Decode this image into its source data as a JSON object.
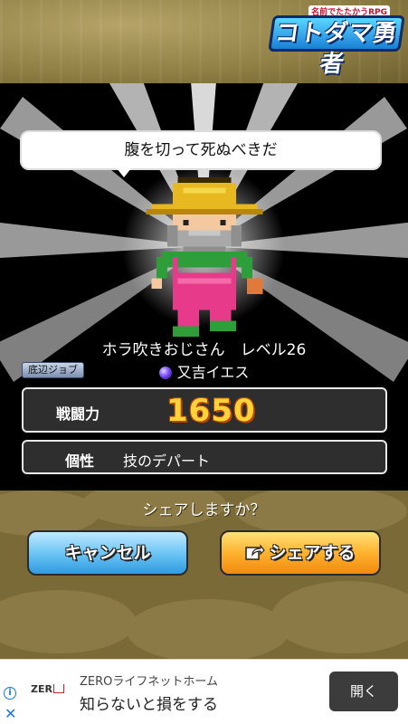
{
  "logo": {
    "subtitle": "名前でたたかうRPG",
    "title": "コトダマ勇者"
  },
  "speech": "腹を切って死ぬべきだ",
  "character": {
    "name_line": "ホラ吹きおじさん　レベル26",
    "job_badge": "底辺ジョブ",
    "job": "又吉イエス"
  },
  "stats": {
    "power_label": "戦闘力",
    "power_value": "1650",
    "trait_label": "個性",
    "trait_value": "技のデパート"
  },
  "share_prompt": "シェアしますか？",
  "buttons": {
    "cancel": "キャンセル",
    "share": "シェアする"
  },
  "ad": {
    "logo_text": "ZER",
    "title": "ZEROライフネットホーム",
    "text": "知らないと損をする",
    "button": "開く",
    "info": "i",
    "close": "✕"
  },
  "colors": {
    "power_text": "#ffd23a",
    "cancel_button": "#6ec6f5",
    "share_button": "#ffb22e"
  }
}
